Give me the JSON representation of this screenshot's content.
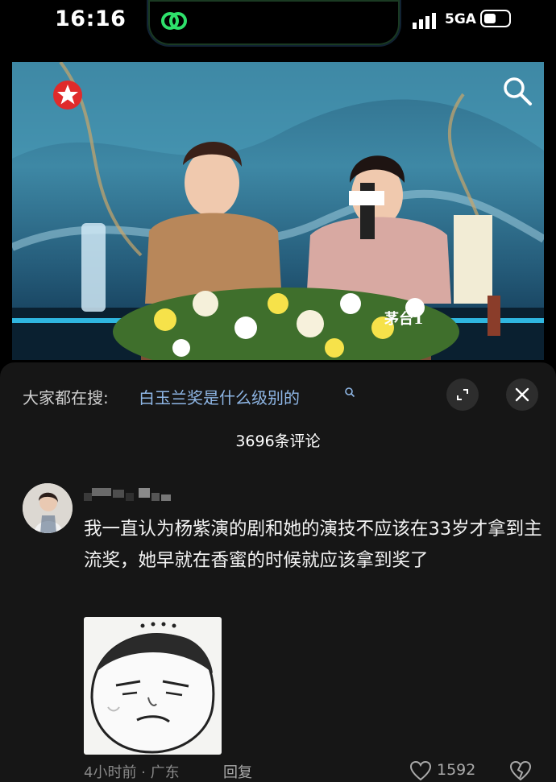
{
  "status_bar": {
    "time": "16:16",
    "network": "5GA"
  },
  "video": {
    "watermark": "茅台1"
  },
  "search_bar": {
    "prefix": "大家都在搜:",
    "query": "白玉兰奖是什么级别的"
  },
  "comments_header": {
    "count_label": "3696条评论"
  },
  "comment": {
    "text": "我一直认为杨紫演的剧和她的演技不应该在33岁才拿到主流奖，她早就在香蜜的时候就应该拿到奖了",
    "time": "4小时前",
    "location": "广东",
    "meta": "4小时前 · 广东",
    "reply_label": "回复",
    "likes": "1592"
  },
  "icons": {
    "channel_logo": "star-logo-icon",
    "video_search": "search-icon",
    "expand": "expand-icon",
    "close": "close-icon",
    "like": "heart-icon",
    "dislike": "broken-heart-icon"
  },
  "colors": {
    "link": "#8fb7e6",
    "sheet_bg": "#161616",
    "accent_red": "#e02b2b"
  }
}
